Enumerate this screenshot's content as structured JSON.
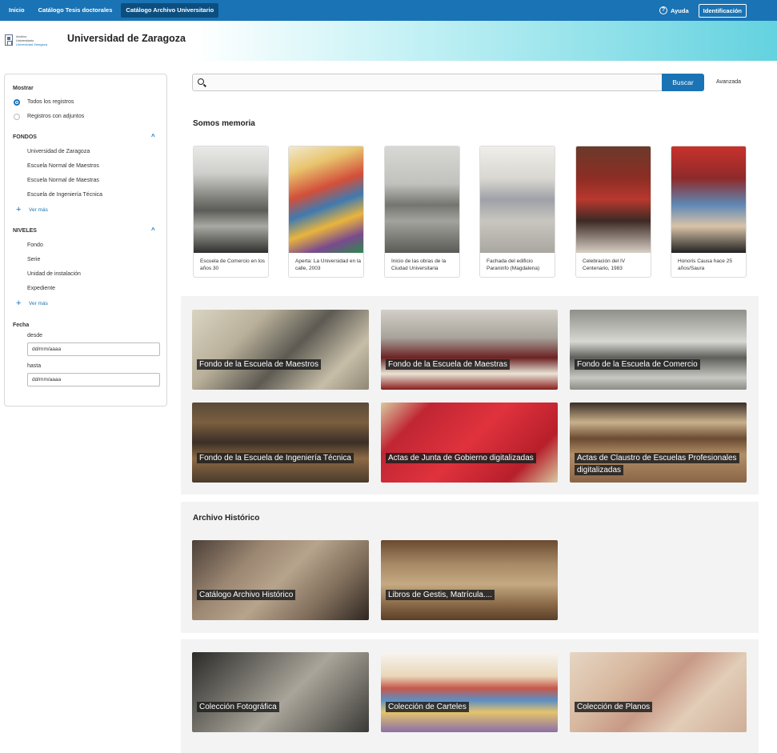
{
  "nav": {
    "tabs": [
      "Inicio",
      "Catálogo Tesis doctorales",
      "Catálogo Archivo Universitario"
    ],
    "help_label": "Ayuda",
    "help_glyph": "?",
    "login_label": "Identificación"
  },
  "header": {
    "logo_lines": [
      "Archivo",
      "Universitario",
      "Universidad Zaragoza"
    ],
    "site_title": "Universidad de Zaragoza"
  },
  "sidebar": {
    "show_heading": "Mostrar",
    "show_options": [
      {
        "label": "Todos los registros",
        "selected": true
      },
      {
        "label": "Registros con adjuntos",
        "selected": false
      }
    ],
    "fondos": {
      "heading": "FONDOS",
      "items": [
        "Universidad de Zaragoza",
        "Escuela Normal de Maestros",
        "Escuela Normal de Maestras",
        "Escuela de Ingeniería Técnica"
      ],
      "more": "Ver más"
    },
    "niveles": {
      "heading": "NIVELES",
      "items": [
        "Fondo",
        "Serie",
        "Unidad de instalación",
        "Expediente"
      ],
      "more": "Ver más"
    },
    "fecha": {
      "heading": "Fecha",
      "desde_label": "desde",
      "desde_value": "dd/mm/aaaa",
      "hasta_label": "hasta",
      "hasta_value": "dd/mm/aaaa"
    },
    "chevron": "^",
    "plus": "+"
  },
  "search": {
    "value": "",
    "button": "Buscar",
    "advanced": "Avanzada"
  },
  "memoria": {
    "title": "Somos memoria",
    "cards": [
      {
        "caption": "Escuela de Comercio en los años 30"
      },
      {
        "caption": "Aperta: La Universidad en la calle, 2003"
      },
      {
        "caption": "Inicio de las obras de la Ciudad Universitaria"
      },
      {
        "caption": "Fachada del edificio Paraninfo (Magdalena)"
      },
      {
        "caption": "Celebración del IV Centenario, 1983"
      },
      {
        "caption": "Honoris Causa hace 25 años/Saura"
      }
    ]
  },
  "fondos_tiles": [
    {
      "label": "Fondo de la Escuela de Maestros"
    },
    {
      "label": "Fondo de la Escuela de Maestras"
    },
    {
      "label": "Fondo de la Escuela de Comercio"
    },
    {
      "label": "Fondo de la Escuela de Ingeniería Técnica"
    },
    {
      "label": "Actas de Junta de Gobierno digitalizadas"
    },
    {
      "label": "Actas de Claustro de Escuelas Profesionales digitalizadas"
    }
  ],
  "historico": {
    "title": "Archivo Histórico",
    "tiles": [
      {
        "label": "Catálogo Archivo Histórico"
      },
      {
        "label": "Libros de Gestis, Matrícula...."
      }
    ]
  },
  "colecciones": [
    {
      "label": "Colección Fotográfica"
    },
    {
      "label": "Colección de Carteles"
    },
    {
      "label": "Colección de Planos"
    }
  ]
}
